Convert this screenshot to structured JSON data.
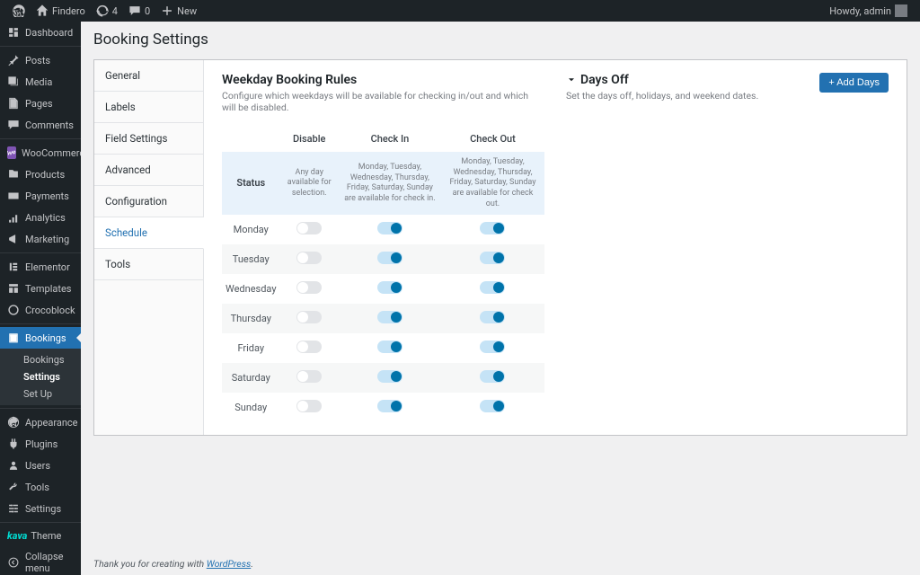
{
  "topbar": {
    "site_name": "Findero",
    "updates_count": "4",
    "comments_count": "0",
    "new_label": "New",
    "howdy": "Howdy, admin"
  },
  "sidebar": {
    "items": [
      {
        "label": "Dashboard",
        "icon": "dashboard"
      },
      {
        "label": "Posts",
        "icon": "pin"
      },
      {
        "label": "Media",
        "icon": "media"
      },
      {
        "label": "Pages",
        "icon": "pages"
      },
      {
        "label": "Comments",
        "icon": "comments"
      },
      {
        "label": "WooCommerce",
        "icon": "woo"
      },
      {
        "label": "Products",
        "icon": "products"
      },
      {
        "label": "Payments",
        "icon": "payments"
      },
      {
        "label": "Analytics",
        "icon": "analytics"
      },
      {
        "label": "Marketing",
        "icon": "marketing"
      },
      {
        "label": "Elementor",
        "icon": "elementor"
      },
      {
        "label": "Templates",
        "icon": "templates"
      },
      {
        "label": "Crocoblock",
        "icon": "croco"
      },
      {
        "label": "Bookings",
        "icon": "bookings",
        "current": true,
        "sub": [
          {
            "label": "Bookings"
          },
          {
            "label": "Settings",
            "active": true
          },
          {
            "label": "Set Up"
          }
        ]
      },
      {
        "label": "Appearance",
        "icon": "appearance"
      },
      {
        "label": "Plugins",
        "icon": "plugins"
      },
      {
        "label": "Users",
        "icon": "users"
      },
      {
        "label": "Tools",
        "icon": "tools"
      },
      {
        "label": "Settings",
        "icon": "settings"
      }
    ],
    "theme_brand": "kava",
    "theme_label": "Theme",
    "collapse_label": "Collapse menu"
  },
  "page": {
    "title": "Booking Settings",
    "tabs": [
      "General",
      "Labels",
      "Field Settings",
      "Advanced",
      "Configuration",
      "Schedule",
      "Tools"
    ],
    "active_tab": 5
  },
  "rules": {
    "title": "Weekday Booking Rules",
    "desc": "Configure which weekdays will be available for checking in/out and which will be disabled.",
    "columns": [
      "",
      "Disable",
      "Check In",
      "Check Out"
    ],
    "status_label": "Status",
    "status_disable": "Any day available for selection.",
    "status_checkin": "Monday, Tuesday, Wednesday, Thursday, Friday, Saturday, Sunday are available for check in.",
    "status_checkout": "Monday, Tuesday, Wednesday, Thursday, Friday, Saturday, Sunday are available for check out.",
    "days": [
      {
        "name": "Monday",
        "disable": false,
        "checkin": true,
        "checkout": true
      },
      {
        "name": "Tuesday",
        "disable": false,
        "checkin": true,
        "checkout": true
      },
      {
        "name": "Wednesday",
        "disable": false,
        "checkin": true,
        "checkout": true
      },
      {
        "name": "Thursday",
        "disable": false,
        "checkin": true,
        "checkout": true
      },
      {
        "name": "Friday",
        "disable": false,
        "checkin": true,
        "checkout": true
      },
      {
        "name": "Saturday",
        "disable": false,
        "checkin": true,
        "checkout": true
      },
      {
        "name": "Sunday",
        "disable": false,
        "checkin": true,
        "checkout": true
      }
    ]
  },
  "daysoff": {
    "title": "Days Off",
    "desc": "Set the days off, holidays, and weekend dates.",
    "add_button": "+ Add Days"
  },
  "footer": {
    "text": "Thank you for creating with ",
    "link_text": "WordPress",
    "period": "."
  }
}
